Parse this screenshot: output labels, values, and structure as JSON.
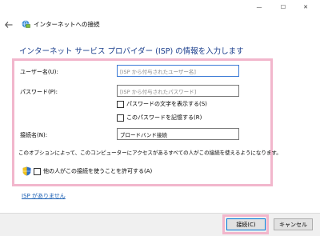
{
  "window": {
    "title": "インターネットへの接続",
    "controls": {
      "minimize": "—",
      "maximize": "☐",
      "close": "✕"
    }
  },
  "heading": "インターネット サービス プロバイダー (ISP) の情報を入力します",
  "form": {
    "username_label": "ユーザー名(U):",
    "username_placeholder": "[ISP から付与されたユーザー名]",
    "password_label": "パスワード(P):",
    "password_placeholder": "[ISP から付与されたパスワード]",
    "show_password_label": "パスワードの文字を表示する(S)",
    "remember_password_label": "このパスワードを記憶する(R)",
    "connection_name_label": "接続名(N):",
    "connection_name_value": "ブロードバンド接続",
    "info_text": "このオプションによって、このコンピューターにアクセスがあるすべての人がこの接続を使えるようになります。",
    "allow_others_label": "他の人がこの接続を使うことを許可する(A)"
  },
  "no_isp_link": "ISP がありません",
  "buttons": {
    "connect": "接続(C)",
    "cancel": "キャンセル"
  },
  "colors": {
    "heading": "#1a3e8c",
    "highlight_frame": "#f2b6cc",
    "link": "#1a5fb4",
    "accent": "#0078d7"
  },
  "icons": {
    "back": "back-arrow-icon",
    "title": "network-connection-icon",
    "shield": "uac-shield-icon"
  }
}
